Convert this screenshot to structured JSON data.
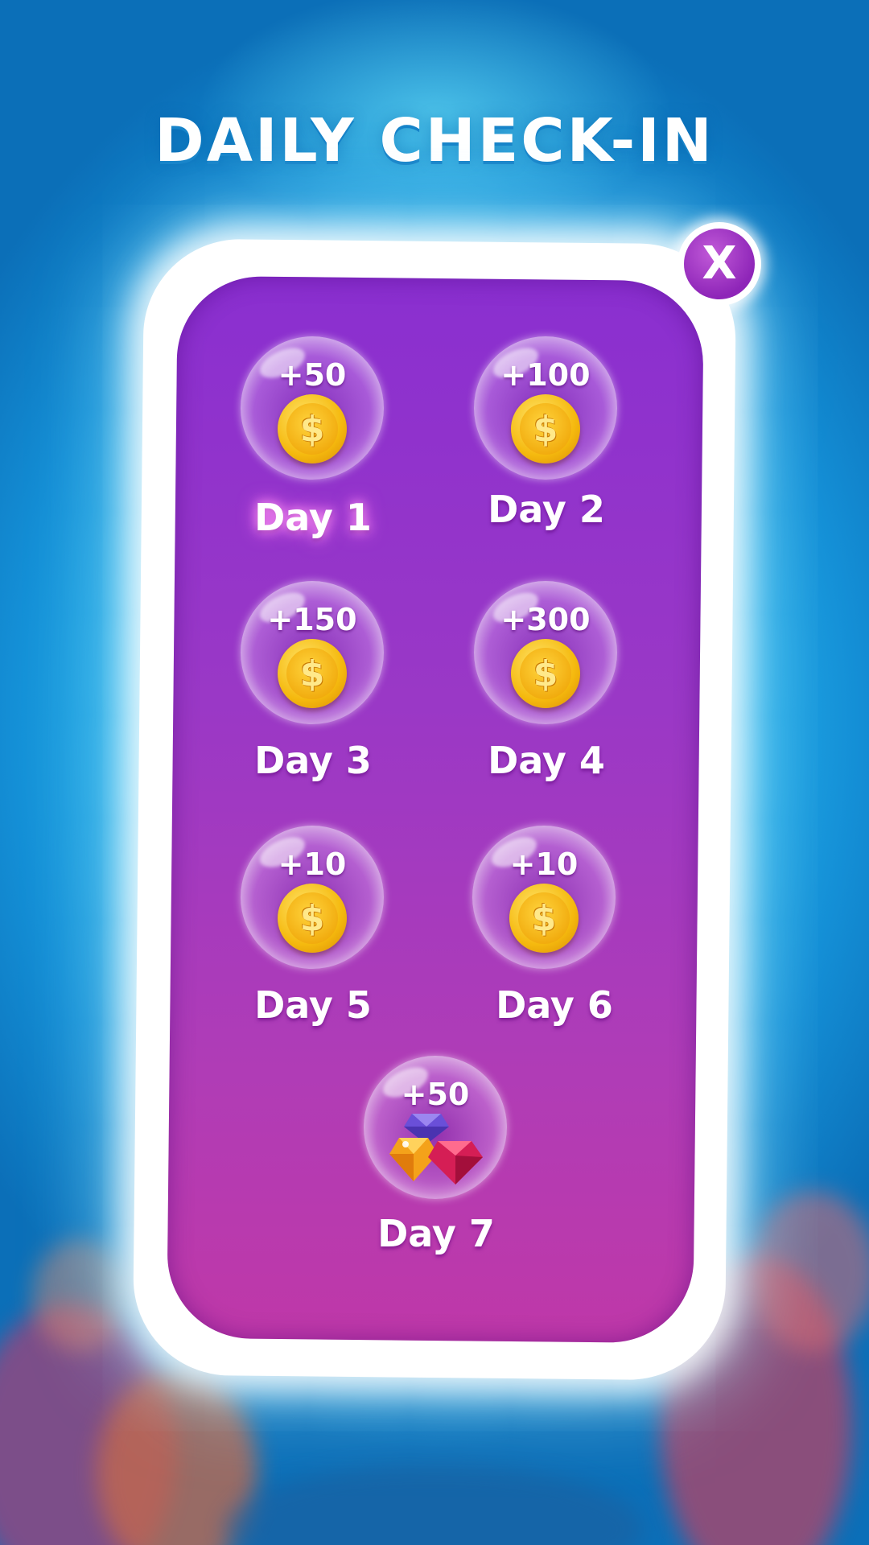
{
  "title": "DAILY CHECK-IN",
  "close_button": {
    "label": "X"
  },
  "rewards": [
    {
      "day": "Day 1",
      "amount": "+50",
      "icon": "coin-icon",
      "active": true
    },
    {
      "day": "Day 2",
      "amount": "+100",
      "icon": "coin-icon",
      "active": false
    },
    {
      "day": "Day 3",
      "amount": "+150",
      "icon": "coin-icon",
      "active": false
    },
    {
      "day": "Day 4",
      "amount": "+300",
      "icon": "coin-icon",
      "active": false
    },
    {
      "day": "Day 5",
      "amount": "+10",
      "icon": "coin-icon",
      "active": false
    },
    {
      "day": "Day 6",
      "amount": "+10",
      "icon": "coin-icon",
      "active": false
    },
    {
      "day": "Day 7",
      "amount": "+50",
      "icon": "gems-icon",
      "active": false
    }
  ],
  "coin_symbol": "$",
  "colors": {
    "background": "#29b8f0",
    "panel": "#9a38c6",
    "coin": "#f5b90e",
    "active_glow": "#ff6ef0"
  }
}
